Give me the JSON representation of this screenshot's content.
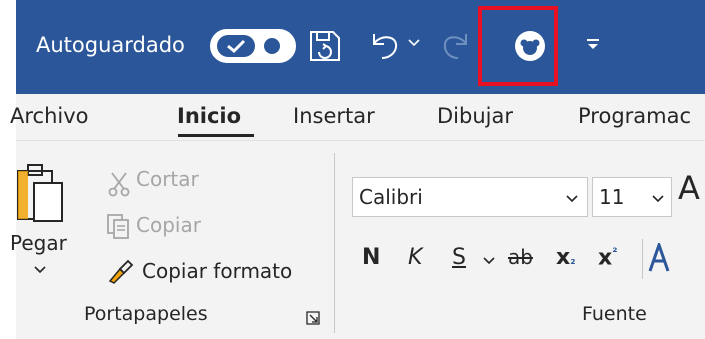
{
  "quick_access": {
    "autosave_label": "Autoguardado",
    "autosave_state": "on",
    "icons": [
      "save-icon",
      "undo-icon",
      "undo-dropdown-icon",
      "redo-icon",
      "avatar-icon",
      "customize-toolbar-icon"
    ],
    "highlight_color": "#e81123",
    "title_bar_color": "#2b579a"
  },
  "tabs": [
    {
      "label": "Archivo",
      "active": false
    },
    {
      "label": "Inicio",
      "active": true
    },
    {
      "label": "Insertar",
      "active": false
    },
    {
      "label": "Dibujar",
      "active": false
    },
    {
      "label": "Programac",
      "active": false
    }
  ],
  "clipboard": {
    "paste_label": "Pegar",
    "cut_label": "Cortar",
    "copy_label": "Copiar",
    "format_painter_label": "Copiar formato",
    "group_label": "Portapapeles"
  },
  "font": {
    "font_name": "Calibri",
    "font_size": "11",
    "bold_label": "N",
    "italic_label": "K",
    "underline_label": "S",
    "strikethrough_label": "ab",
    "subscript_label": "x",
    "subscript_mark": "₂",
    "superscript_label": "x",
    "superscript_mark": "²",
    "grow_label": "A",
    "group_label": "Fuente"
  }
}
